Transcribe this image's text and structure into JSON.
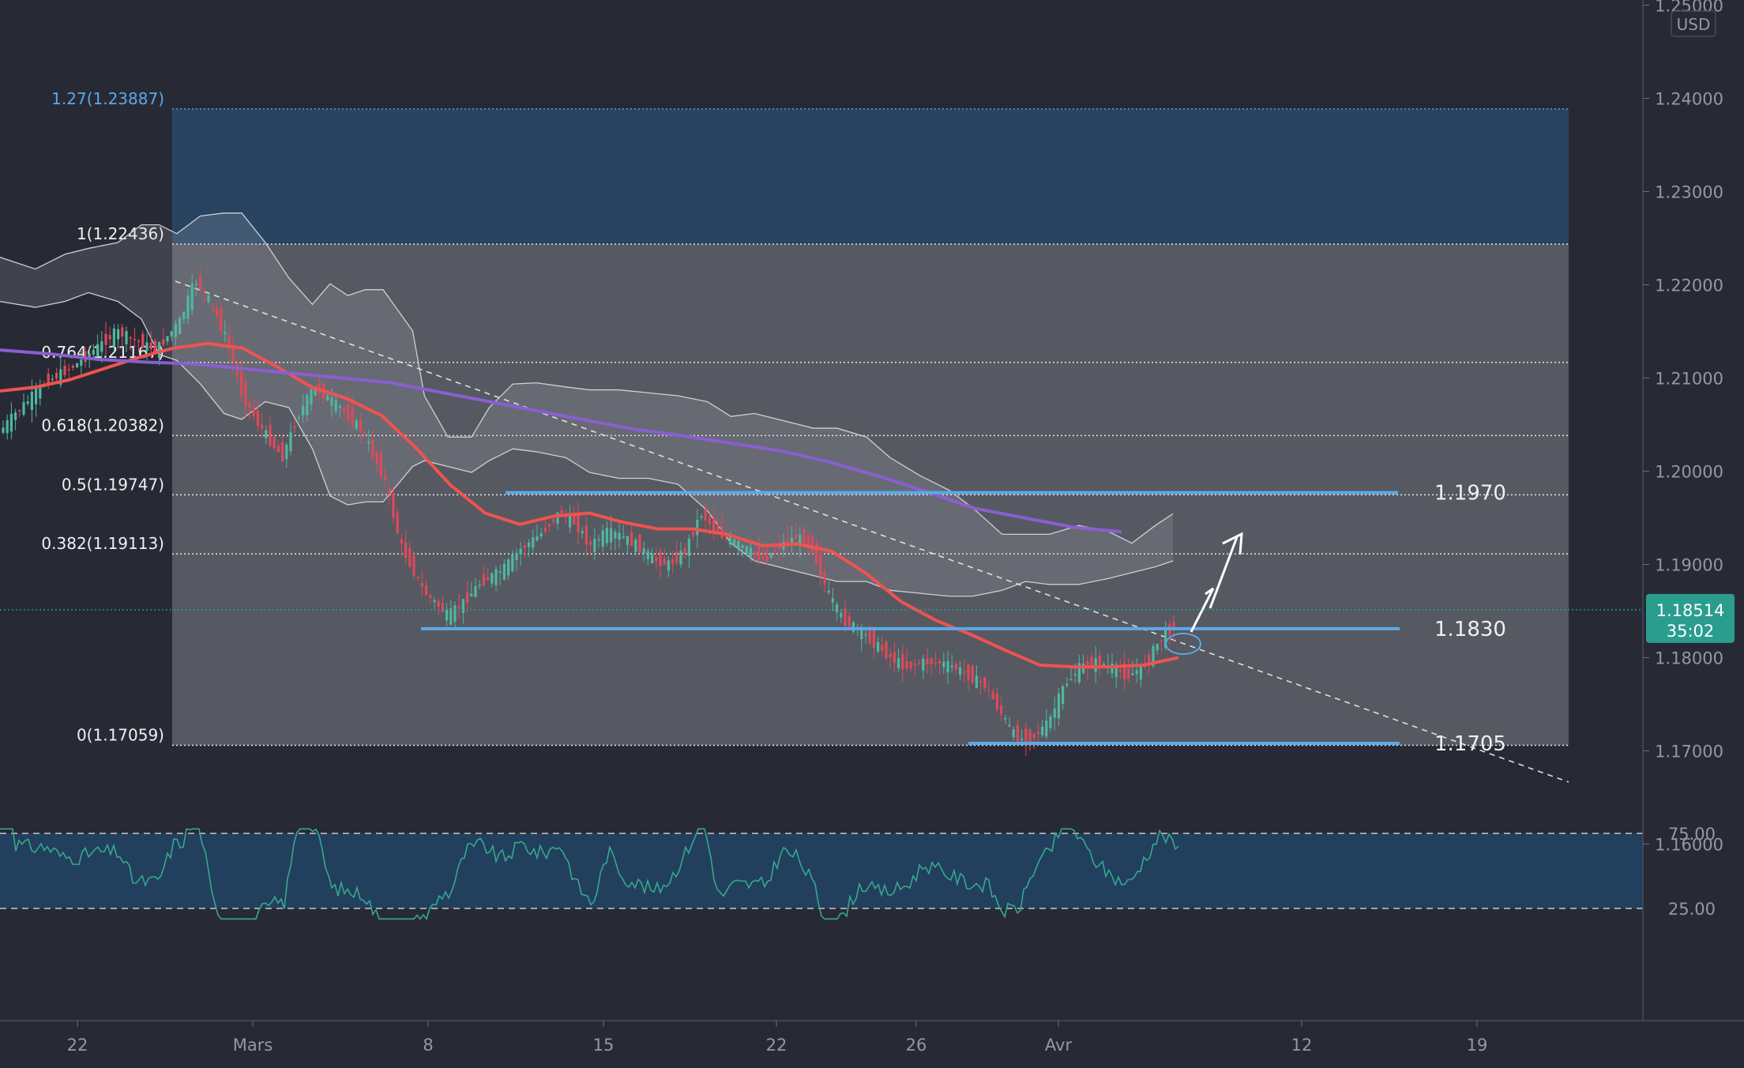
{
  "currency_label": "USD",
  "price_axis": {
    "ticks": [
      "1.25000",
      "1.24000",
      "1.23000",
      "1.22000",
      "1.21000",
      "1.20000",
      "1.19000",
      "1.18000",
      "1.17000",
      "1.16000"
    ],
    "tick_values": [
      1.25,
      1.24,
      1.23,
      1.22,
      1.21,
      1.2,
      1.19,
      1.18,
      1.17,
      1.16
    ]
  },
  "time_axis": {
    "labels": [
      "22",
      "Mars",
      "8",
      "15",
      "22",
      "26",
      "Avr",
      "12",
      "19"
    ]
  },
  "current_price": {
    "value": "1.18514",
    "countdown": "35:02"
  },
  "fibonacci": {
    "levels": [
      {
        "label": "1.27(1.23887)",
        "value": 1.23887
      },
      {
        "label": "1(1.22436)",
        "value": 1.22436
      },
      {
        "label": "0.764(1.21167)",
        "value": 1.21167
      },
      {
        "label": "0.618(1.20382)",
        "value": 1.20382
      },
      {
        "label": "0.5(1.19747)",
        "value": 1.19747
      },
      {
        "label": "0.382(1.19113)",
        "value": 1.19113
      },
      {
        "label": "0(1.17059)",
        "value": 1.17059
      }
    ]
  },
  "horizontal_levels": [
    {
      "label": "1.1970",
      "value": 1.1977
    },
    {
      "label": "1.1830",
      "value": 1.1831
    },
    {
      "label": "1.1705",
      "value": 1.1708
    }
  ],
  "rsi_panel": {
    "ticks": [
      "75.00",
      "25.00"
    ],
    "tick_values": [
      75,
      25
    ]
  },
  "colors": {
    "background": "#272a34",
    "fib_zone": "#565961",
    "extension_zone": "#284461",
    "level_line": "#5ca8e8",
    "ema_fast": "#ef5350",
    "ma_slow": "#8a5fd0",
    "bullish": "#4fb7a0",
    "bearish": "#e0495a",
    "rsi_line": "#36a88a",
    "rsi_band": "#223f5e"
  },
  "chart_data": {
    "type": "candlestick",
    "title": "",
    "y_range": [
      1.155,
      1.2525
    ],
    "x_labels": [
      "22",
      "Mars",
      "8",
      "15",
      "22",
      "26",
      "Avr",
      "12",
      "19"
    ],
    "series": [
      {
        "name": "",
        "kind": "ema",
        "values": [
          1.2086,
          1.209,
          1.2098,
          1.211,
          1.2122,
          1.2132,
          1.2137,
          1.2132,
          1.2112,
          1.209,
          1.2078,
          1.206,
          1.2025,
          1.1985,
          1.1955,
          1.1943,
          1.1952,
          1.1955,
          1.1945,
          1.1938,
          1.1938,
          1.1932,
          1.192,
          1.1922,
          1.1914,
          1.189,
          1.186,
          1.184,
          1.1825,
          1.1808,
          1.1792,
          1.179,
          1.179,
          1.1792,
          1.18
        ]
      },
      {
        "name": "",
        "kind": "ma",
        "values": [
          1.213,
          1.2126,
          1.212,
          1.2117,
          1.2115,
          1.211,
          1.2105,
          1.21,
          1.2095,
          1.2085,
          1.2075,
          1.2065,
          1.2055,
          1.2045,
          1.2038,
          1.203,
          1.2022,
          1.201,
          1.1995,
          1.1978,
          1.196,
          1.195,
          1.194,
          1.1935
        ]
      }
    ]
  }
}
